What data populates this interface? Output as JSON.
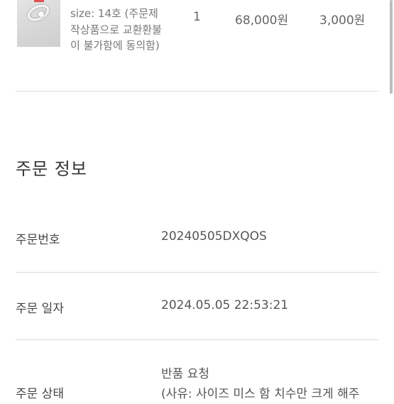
{
  "product": {
    "option_text": "size: 14호 (주문제작상품으로 교환환불이 불가함에 동의함)",
    "quantity": "1",
    "price": "68,000원",
    "shipping": "3,000원"
  },
  "order_info": {
    "title": "주문 정보",
    "number_label": "주문번호",
    "number_value": "20240505DXQOS",
    "date_label": "주문 일자",
    "date_value": "2024.05.05 22:53:21",
    "status_label": "주문 상태",
    "status_value": "반품 요청",
    "status_reason": "(사유: 사이즈 미스 함 치수만 크게 해주"
  }
}
